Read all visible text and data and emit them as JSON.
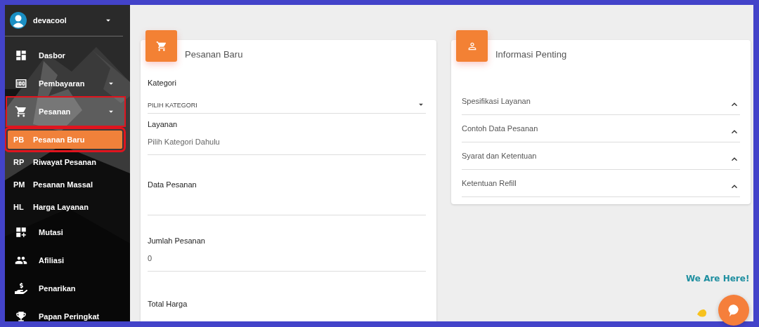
{
  "user": {
    "name": "devacool"
  },
  "sidebar": {
    "items": [
      {
        "label": "Dasbor",
        "expandable": false,
        "selected": false,
        "highlighted": false
      },
      {
        "label": "Pembayaran",
        "expandable": true,
        "selected": false,
        "highlighted": false
      },
      {
        "label": "Pesanan",
        "expandable": true,
        "selected": true,
        "highlighted": true,
        "children": [
          {
            "abbr": "PB",
            "label": "Pesanan Baru",
            "selected": true,
            "highlighted": true
          },
          {
            "abbr": "RP",
            "label": "Riwayat Pesanan",
            "selected": false,
            "highlighted": false
          },
          {
            "abbr": "PM",
            "label": "Pesanan Massal",
            "selected": false,
            "highlighted": false
          },
          {
            "abbr": "HL",
            "label": "Harga Layanan",
            "selected": false,
            "highlighted": false
          }
        ]
      },
      {
        "label": "Mutasi",
        "expandable": false,
        "selected": false,
        "highlighted": false
      },
      {
        "label": "Afiliasi",
        "expandable": false,
        "selected": false,
        "highlighted": false
      },
      {
        "label": "Penarikan",
        "expandable": false,
        "selected": false,
        "highlighted": false
      },
      {
        "label": "Papan Peringkat",
        "expandable": false,
        "selected": false,
        "highlighted": false
      }
    ]
  },
  "order_card": {
    "title": "Pesanan Baru",
    "fields": [
      {
        "kind": "select",
        "label": "Kategori",
        "value": "PILIH KATEGORI"
      },
      {
        "kind": "input",
        "label": "Layanan",
        "placeholder": "Pilih Kategori Dahulu"
      },
      {
        "kind": "textarea",
        "label": "Data Pesanan"
      },
      {
        "kind": "input",
        "label": "Jumlah Pesanan",
        "value": "0"
      },
      {
        "kind": "input",
        "label": "Total Harga"
      }
    ]
  },
  "info_card": {
    "title": "Informasi Penting",
    "sections": [
      {
        "label": "Spesifikasi Layanan",
        "expanded": false
      },
      {
        "label": "Contoh Data Pesanan",
        "expanded": false
      },
      {
        "label": "Syarat dan Ketentuan",
        "expanded": false
      },
      {
        "label": "Ketentuan Refill",
        "expanded": false
      }
    ]
  },
  "chat": {
    "caption": "We Are Here!"
  }
}
